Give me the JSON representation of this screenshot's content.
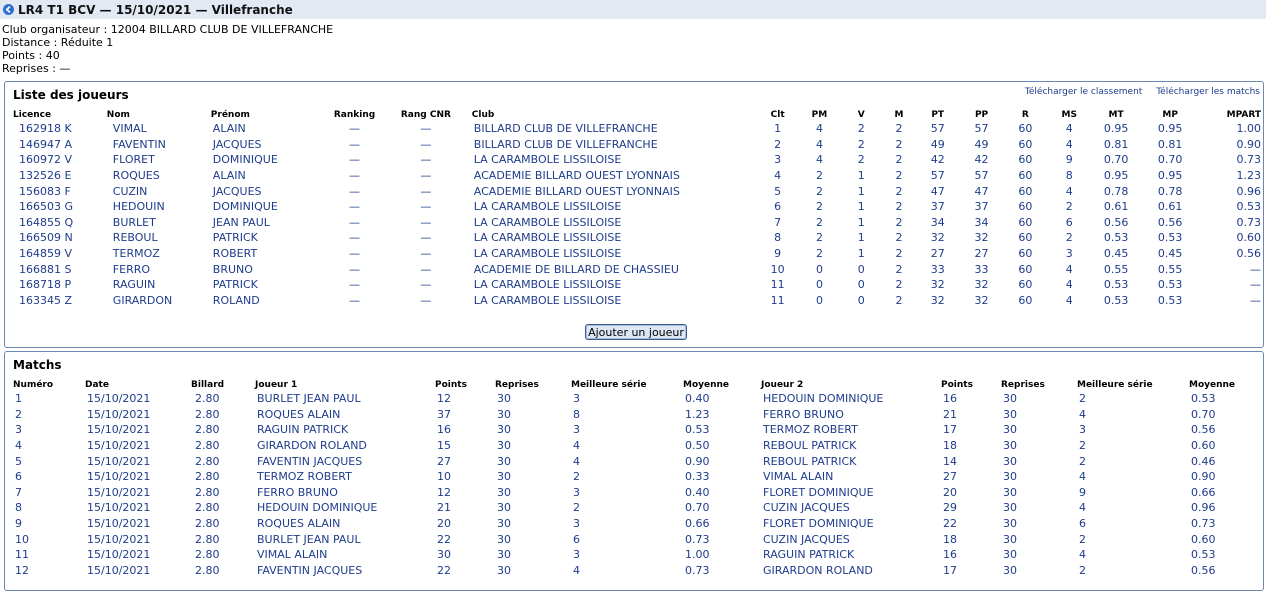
{
  "header": {
    "title": "LR4 T1 BCV — 15/10/2021 — Villefranche"
  },
  "info": [
    "Club organisateur : 12004 BILLARD CLUB DE VILLEFRANCHE",
    "Distance : Réduite 1",
    "Points : 40",
    "Reprises : —"
  ],
  "players": {
    "title": "Liste des joueurs",
    "download_ranking": "Télécharger le classement",
    "download_matches": "Télécharger les matchs",
    "headers": [
      "Licence",
      "Nom",
      "Prénom",
      "Ranking",
      "Rang CNR",
      "Club",
      "Clt",
      "PM",
      "V",
      "M",
      "PT",
      "PP",
      "R",
      "MS",
      "MT",
      "MP",
      "MPART"
    ],
    "rows": [
      [
        "162918 K",
        "VIMAL",
        "ALAIN",
        "—",
        "—",
        "BILLARD CLUB DE VILLEFRANCHE",
        "1",
        "4",
        "2",
        "2",
        "57",
        "57",
        "60",
        "4",
        "0.95",
        "0.95",
        "1.00"
      ],
      [
        "146947 A",
        "FAVENTIN",
        "JACQUES",
        "—",
        "—",
        "BILLARD CLUB DE VILLEFRANCHE",
        "2",
        "4",
        "2",
        "2",
        "49",
        "49",
        "60",
        "4",
        "0.81",
        "0.81",
        "0.90"
      ],
      [
        "160972 V",
        "FLORET",
        "DOMINIQUE",
        "—",
        "—",
        "LA CARAMBOLE LISSILOISE",
        "3",
        "4",
        "2",
        "2",
        "42",
        "42",
        "60",
        "9",
        "0.70",
        "0.70",
        "0.73"
      ],
      [
        "132526 E",
        "ROQUES",
        "ALAIN",
        "—",
        "—",
        "ACADEMIE BILLARD OUEST LYONNAIS",
        "4",
        "2",
        "1",
        "2",
        "57",
        "57",
        "60",
        "8",
        "0.95",
        "0.95",
        "1.23"
      ],
      [
        "156083 F",
        "CUZIN",
        "JACQUES",
        "—",
        "—",
        "ACADEMIE BILLARD OUEST LYONNAIS",
        "5",
        "2",
        "1",
        "2",
        "47",
        "47",
        "60",
        "4",
        "0.78",
        "0.78",
        "0.96"
      ],
      [
        "166503 G",
        "HEDOUIN",
        "DOMINIQUE",
        "—",
        "—",
        "LA CARAMBOLE LISSILOISE",
        "6",
        "2",
        "1",
        "2",
        "37",
        "37",
        "60",
        "2",
        "0.61",
        "0.61",
        "0.53"
      ],
      [
        "164855 Q",
        "BURLET",
        "JEAN PAUL",
        "—",
        "—",
        "LA CARAMBOLE LISSILOISE",
        "7",
        "2",
        "1",
        "2",
        "34",
        "34",
        "60",
        "6",
        "0.56",
        "0.56",
        "0.73"
      ],
      [
        "166509 N",
        "REBOUL",
        "PATRICK",
        "—",
        "—",
        "LA CARAMBOLE LISSILOISE",
        "8",
        "2",
        "1",
        "2",
        "32",
        "32",
        "60",
        "2",
        "0.53",
        "0.53",
        "0.60"
      ],
      [
        "164859 V",
        "TERMOZ",
        "ROBERT",
        "—",
        "—",
        "LA CARAMBOLE LISSILOISE",
        "9",
        "2",
        "1",
        "2",
        "27",
        "27",
        "60",
        "3",
        "0.45",
        "0.45",
        "0.56"
      ],
      [
        "166881 S",
        "FERRO",
        "BRUNO",
        "—",
        "—",
        "ACADEMIE DE BILLARD DE CHASSIEU",
        "10",
        "0",
        "0",
        "2",
        "33",
        "33",
        "60",
        "4",
        "0.55",
        "0.55",
        "—"
      ],
      [
        "168718 P",
        "RAGUIN",
        "PATRICK",
        "—",
        "—",
        "LA CARAMBOLE LISSILOISE",
        "11",
        "0",
        "0",
        "2",
        "32",
        "32",
        "60",
        "4",
        "0.53",
        "0.53",
        "—"
      ],
      [
        "163345 Z",
        "GIRARDON",
        "ROLAND",
        "—",
        "—",
        "LA CARAMBOLE LISSILOISE",
        "11",
        "0",
        "0",
        "2",
        "32",
        "32",
        "60",
        "4",
        "0.53",
        "0.53",
        "—"
      ]
    ],
    "add_player_label": "Ajouter un joueur"
  },
  "matches": {
    "title": "Matchs",
    "headers": [
      "Numéro",
      "Date",
      "Billard",
      "Joueur 1",
      "Points",
      "Reprises",
      "Meilleure série",
      "Moyenne",
      "Joueur 2",
      "Points",
      "Reprises",
      "Meilleure série",
      "Moyenne"
    ],
    "rows": [
      [
        "1",
        "15/10/2021",
        "2.80",
        "BURLET JEAN PAUL",
        "12",
        "30",
        "3",
        "0.40",
        "HEDOUIN DOMINIQUE",
        "16",
        "30",
        "2",
        "0.53"
      ],
      [
        "2",
        "15/10/2021",
        "2.80",
        "ROQUES ALAIN",
        "37",
        "30",
        "8",
        "1.23",
        "FERRO BRUNO",
        "21",
        "30",
        "4",
        "0.70"
      ],
      [
        "3",
        "15/10/2021",
        "2.80",
        "RAGUIN PATRICK",
        "16",
        "30",
        "3",
        "0.53",
        "TERMOZ ROBERT",
        "17",
        "30",
        "3",
        "0.56"
      ],
      [
        "4",
        "15/10/2021",
        "2.80",
        "GIRARDON ROLAND",
        "15",
        "30",
        "4",
        "0.50",
        "REBOUL PATRICK",
        "18",
        "30",
        "2",
        "0.60"
      ],
      [
        "5",
        "15/10/2021",
        "2.80",
        "FAVENTIN JACQUES",
        "27",
        "30",
        "4",
        "0.90",
        "REBOUL PATRICK",
        "14",
        "30",
        "2",
        "0.46"
      ],
      [
        "6",
        "15/10/2021",
        "2.80",
        "TERMOZ ROBERT",
        "10",
        "30",
        "2",
        "0.33",
        "VIMAL ALAIN",
        "27",
        "30",
        "4",
        "0.90"
      ],
      [
        "7",
        "15/10/2021",
        "2.80",
        "FERRO BRUNO",
        "12",
        "30",
        "3",
        "0.40",
        "FLORET DOMINIQUE",
        "20",
        "30",
        "9",
        "0.66"
      ],
      [
        "8",
        "15/10/2021",
        "2.80",
        "HEDOUIN DOMINIQUE",
        "21",
        "30",
        "2",
        "0.70",
        "CUZIN JACQUES",
        "29",
        "30",
        "4",
        "0.96"
      ],
      [
        "9",
        "15/10/2021",
        "2.80",
        "ROQUES ALAIN",
        "20",
        "30",
        "3",
        "0.66",
        "FLORET DOMINIQUE",
        "22",
        "30",
        "6",
        "0.73"
      ],
      [
        "10",
        "15/10/2021",
        "2.80",
        "BURLET JEAN PAUL",
        "22",
        "30",
        "6",
        "0.73",
        "CUZIN JACQUES",
        "18",
        "30",
        "2",
        "0.60"
      ],
      [
        "11",
        "15/10/2021",
        "2.80",
        "VIMAL ALAIN",
        "30",
        "30",
        "3",
        "1.00",
        "RAGUIN PATRICK",
        "16",
        "30",
        "4",
        "0.53"
      ],
      [
        "12",
        "15/10/2021",
        "2.80",
        "FAVENTIN JACQUES",
        "22",
        "30",
        "4",
        "0.73",
        "GIRARDON ROLAND",
        "17",
        "30",
        "2",
        "0.56"
      ]
    ]
  },
  "colors": {
    "link": "#1f3c8c",
    "titlebar": "#e3e9f3",
    "border": "#6c87b1"
  },
  "icons": {
    "back": "back-arrow-circle-icon"
  }
}
